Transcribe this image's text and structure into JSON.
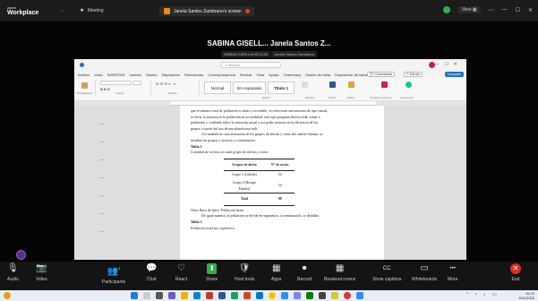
{
  "titlebar": {
    "app_small": "zoom",
    "app_name": "Workplace",
    "meeting_label": "Meeting",
    "share_text": "Janela Santos Zambrano's screen",
    "view_label": "View"
  },
  "share": {
    "title": "SABINA GISELL...  Janela Santos Z...",
    "subtitle_left": "SABINA GISELLA HELLON",
    "subtitle_right": "Janela Santos Zambrano"
  },
  "word": {
    "search_placeholder": "Buscar",
    "menu": [
      "Archivo",
      "Inicio",
      "INSERTAR",
      "Insertar",
      "Diseño",
      "Disposición",
      "Referencias",
      "Correspondencia",
      "Revisar",
      "Vista",
      "Ayuda",
      "Grammarly",
      "Diseño de tabla",
      "Disposición de tabla"
    ],
    "comments_label": "Comentarios",
    "edit_label": "Edición",
    "share_label": "Compartir",
    "styles": [
      "Normal",
      "Sin espaciado",
      "Título 1"
    ],
    "ribbon_labels": {
      "clipboard": "Portapapeles",
      "font": "Fuente",
      "paragraph": "Párrafo",
      "styles": "Estilos",
      "editing": "Edición",
      "dictate": "Dictar",
      "editor": "Editor",
      "reuse": "Reutilizar archivos",
      "grammarly": "Grammarly"
    },
    "body": {
      "p1": "que el número total de población es finito y accesible, se seleccionó una muestra de tipo censal,",
      "p2": "es decir, la muestra es la población en su totalidad, este tipo pregunta abierta (allá, tomar a",
      "p3": "pertinente y confiable sobre la situación actual y así poder mejorar en la eficiencia de los",
      "p4": "grupos a través del uso de una plataforma web.",
      "p5": "Así también la caracterización de los grupos de alertas y cómo del cantón Salinas, se",
      "p6": "detallan los grupos y sectores a continuación:",
      "table1_label": "Tabla 1",
      "table1_caption": "Cantidad de vecinos en cada grupo de alertas y cómo",
      "table1_headers": [
        "Grupos de alerta",
        "N° de socios"
      ],
      "table1_rows": [
        {
          "group": "Grupo 1 (Cabello)",
          "count": "54"
        },
        {
          "group": "Grupo 2 (Bosque Familia)",
          "count": "54"
        }
      ],
      "table1_total": {
        "group": "Total",
        "count": "08"
      },
      "note": "Nota: Base de datos. Población (base",
      "p7": "De igual manera, la población se divide en segmentos, a continuación, se detallan:",
      "table2_label": "Tabla 2",
      "table2_caption": "Población total por segmentos"
    }
  },
  "toolbar": {
    "items": [
      {
        "label": "Audio",
        "icon": "🎙"
      },
      {
        "label": "Video",
        "icon": "📷"
      },
      {
        "label": "Participants",
        "icon": "👥",
        "count": "2"
      },
      {
        "label": "Chat",
        "icon": "💬"
      },
      {
        "label": "React",
        "icon": "♡"
      },
      {
        "label": "Share",
        "icon": "⬆"
      },
      {
        "label": "Host tools",
        "icon": "🛡"
      },
      {
        "label": "Apps",
        "icon": "▦"
      },
      {
        "label": "Record",
        "icon": "⏺"
      },
      {
        "label": "Breakout rooms",
        "icon": "▦"
      },
      {
        "label": "Show captions",
        "icon": "CC"
      },
      {
        "label": "Whiteboards",
        "icon": "▭"
      },
      {
        "label": "More",
        "icon": "•••"
      },
      {
        "label": "End",
        "icon": "✕"
      }
    ]
  },
  "taskbar": {
    "time": "15:23",
    "date": "9/11/2023"
  }
}
